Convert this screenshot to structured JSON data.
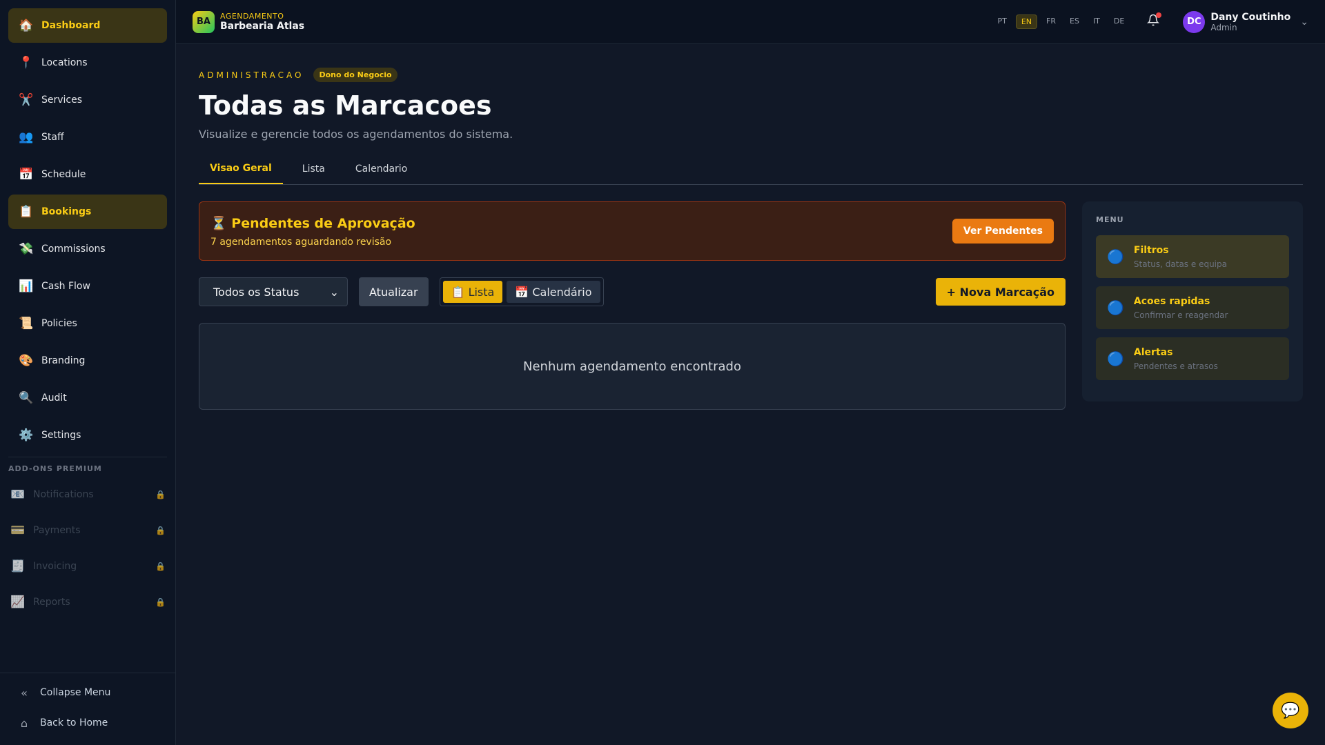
{
  "sidebar": {
    "items": [
      {
        "label": "Dashboard",
        "icon": "🏠",
        "active": true
      },
      {
        "label": "Locations",
        "icon": "📍"
      },
      {
        "label": "Services",
        "icon": "✂️"
      },
      {
        "label": "Staff",
        "icon": "👥"
      },
      {
        "label": "Schedule",
        "icon": "📅"
      },
      {
        "label": "Bookings",
        "icon": "📋",
        "active": true
      },
      {
        "label": "Commissions",
        "icon": "💸"
      },
      {
        "label": "Cash Flow",
        "icon": "📊"
      },
      {
        "label": "Policies",
        "icon": "📜"
      },
      {
        "label": "Branding",
        "icon": "🎨"
      },
      {
        "label": "Audit",
        "icon": "🔍"
      },
      {
        "label": "Settings",
        "icon": "⚙️"
      }
    ],
    "addons_title": "ADD-ONS PREMIUM",
    "addons": [
      {
        "label": "Notifications",
        "icon": "📧",
        "lock": "🔒"
      },
      {
        "label": "Payments",
        "icon": "💳",
        "lock": "🔒"
      },
      {
        "label": "Invoicing",
        "icon": "🧾",
        "lock": "🔒"
      },
      {
        "label": "Reports",
        "icon": "📈",
        "lock": "🔒"
      }
    ],
    "collapse_label": "Collapse Menu",
    "collapse_icon": "«",
    "home_label": "Back to Home",
    "home_icon": "⌂"
  },
  "topbar": {
    "logo_text": "BA",
    "kicker": "AGENDAMENTO",
    "business_name": "Barbearia Atlas",
    "languages": [
      "PT",
      "EN",
      "FR",
      "ES",
      "IT",
      "DE"
    ],
    "active_language": "EN",
    "bell_icon": "🔔",
    "user": {
      "initials": "DC",
      "name": "Dany Coutinho",
      "role": "Admin"
    },
    "chevron_icon": "⌄"
  },
  "page": {
    "kicker": "ADMINISTRACAO",
    "badge": "Dono do Negocio",
    "title": "Todas as Marcacoes",
    "subtitle": "Visualize e gerencie todos os agendamentos do sistema."
  },
  "tabs": [
    {
      "label": "Visao Geral",
      "active": true
    },
    {
      "label": "Lista"
    },
    {
      "label": "Calendario"
    }
  ],
  "pending": {
    "title": "⏳ Pendentes de Aprovação",
    "subtitle": "7 agendamentos aguardando revisão",
    "button": "Ver Pendentes"
  },
  "toolbar": {
    "status_select": "Todos os Status",
    "select_icon": "⌄",
    "refresh_button": "Atualizar",
    "view_list": "📋 Lista",
    "view_calendar": "📅 Calendário",
    "new_button": "+ Nova Marcação"
  },
  "empty_state": "Nenhum agendamento encontrado",
  "side_menu": {
    "title": "MENU",
    "items": [
      {
        "title": "Filtros",
        "subtitle": "Status, datas e equipa",
        "icon": "🔵"
      },
      {
        "title": "Acoes rapidas",
        "subtitle": "Confirmar e reagendar",
        "icon": "🔵"
      },
      {
        "title": "Alertas",
        "subtitle": "Pendentes e atrasos",
        "icon": "🔵"
      }
    ]
  },
  "chat_icon": "💬",
  "colors": {
    "accent": "#facc15",
    "background": "#111827",
    "warning": "#ea7a12"
  }
}
